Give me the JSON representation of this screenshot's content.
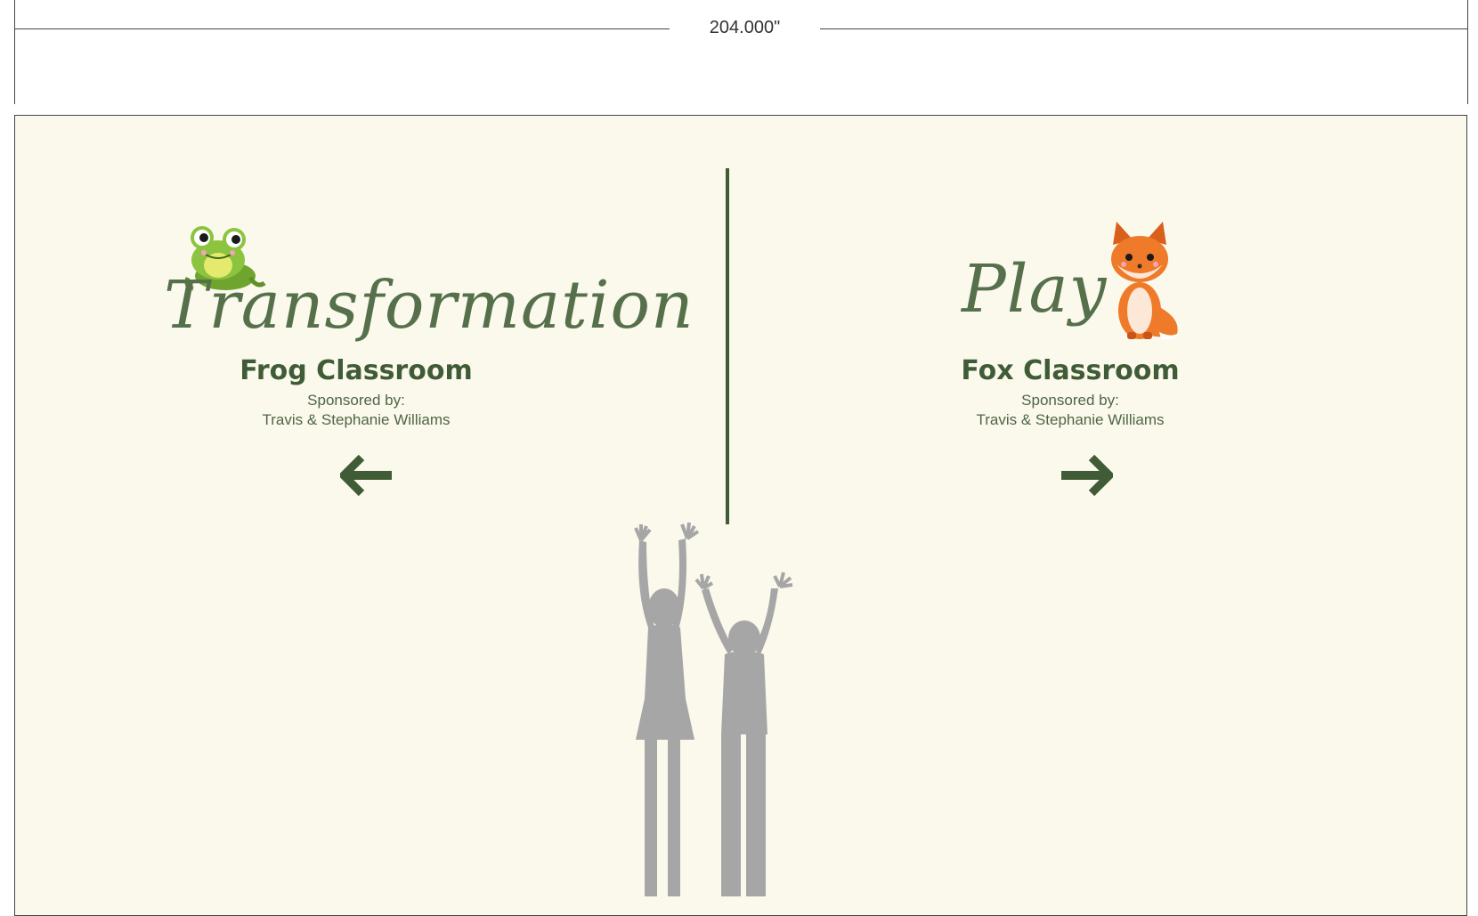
{
  "dimension": {
    "label": "204.000\""
  },
  "left_sign": {
    "script_word": "Transformation",
    "classroom": "Frog Classroom",
    "sponsor_label": "Sponsored by:",
    "sponsor_name": "Travis & Stephanie Williams",
    "arrow_icon": "arrow-left-icon",
    "mascot_icon": "frog-icon"
  },
  "right_sign": {
    "script_word": "Play",
    "classroom": "Fox Classroom",
    "sponsor_label": "Sponsored by:",
    "sponsor_name": "Travis & Stephanie Williams",
    "arrow_icon": "arrow-right-icon",
    "mascot_icon": "fox-icon"
  },
  "colors": {
    "background": "#fbf8ec",
    "accent_green": "#3f5c37",
    "silhouette": "#a6a6a6",
    "frog_green": "#8cc43f",
    "fox_orange": "#ee7a2a"
  }
}
